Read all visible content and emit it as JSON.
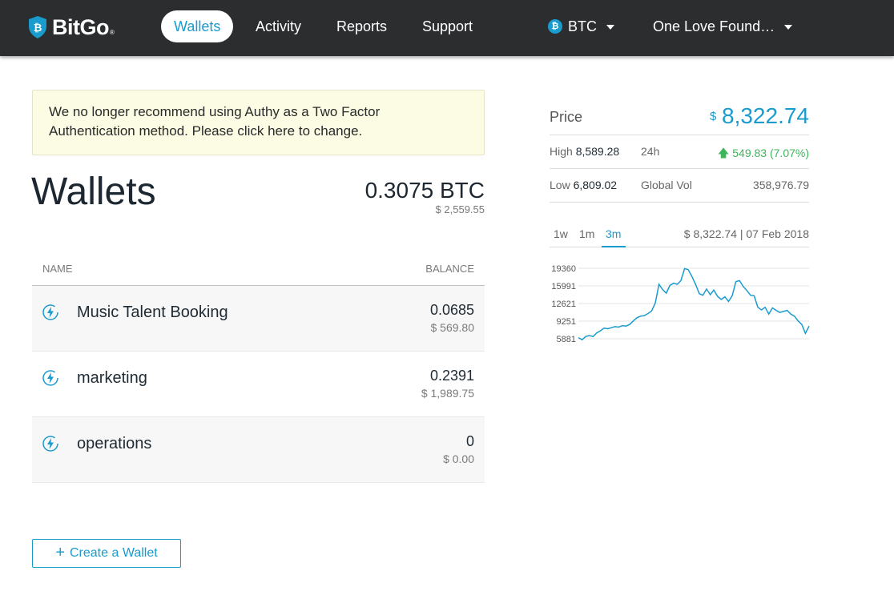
{
  "nav": {
    "logo_text": "BitGo",
    "logo_reg": "®",
    "items": [
      {
        "label": "Wallets",
        "active": true
      },
      {
        "label": "Activity",
        "active": false
      },
      {
        "label": "Reports",
        "active": false
      },
      {
        "label": "Support",
        "active": false
      }
    ],
    "coin": {
      "label": "BTC",
      "icon": "bitcoin-icon"
    },
    "enterprise": {
      "label": "One Love Found…"
    }
  },
  "alert": {
    "text": "We no longer recommend using Authy as a Two Factor Authentication method. Please click here to change."
  },
  "wallets": {
    "title": "Wallets",
    "total_btc": "0.3075 BTC",
    "total_usd": "$ 2,559.55",
    "columns": {
      "name": "NAME",
      "balance": "BALANCE"
    },
    "rows": [
      {
        "name": "Music Talent Booking",
        "balance": "0.0685",
        "usd": "$ 569.80",
        "icon": "lightning-icon"
      },
      {
        "name": "marketing",
        "balance": "0.2391",
        "usd": "$ 1,989.75",
        "icon": "lightning-icon"
      },
      {
        "name": "operations",
        "balance": "0",
        "usd": "$ 0.00",
        "icon": "lightning-icon"
      }
    ],
    "create_label": "Create a Wallet"
  },
  "price_panel": {
    "label": "Price",
    "currency_symbol": "$",
    "price": "8,322.74",
    "high_label": "High",
    "high_value": "8,589.28",
    "period_label": "24h",
    "change": "549.83 (7.07%)",
    "low_label": "Low",
    "low_value": "6,809.02",
    "vol_label": "Global Vol",
    "vol_value": "358,976.79",
    "ranges": [
      "1w",
      "1m",
      "3m"
    ],
    "active_range": "3m",
    "date_text": "$ 8,322.74 | 07 Feb 2018",
    "accent_color": "#1a9bce",
    "up_color": "#3db55a"
  },
  "chart_data": {
    "type": "line",
    "title": "",
    "xlabel": "",
    "ylabel": "",
    "yticks": [
      19360,
      15991,
      12621,
      9251,
      5881
    ],
    "ylim": [
      5881,
      19360
    ],
    "grid": true,
    "series": [
      {
        "values": [
          6100,
          5700,
          6300,
          6500,
          6300,
          7000,
          7400,
          7900,
          7800,
          8000,
          8200,
          8100,
          8400,
          8300,
          8600,
          9300,
          9900,
          10200,
          10300,
          10700,
          11200,
          12700,
          16300,
          15300,
          14600,
          16100,
          16500,
          16300,
          17000,
          19300,
          19100,
          17800,
          16300,
          14500,
          14200,
          15400,
          14300,
          15200,
          14000,
          13400,
          13900,
          13000,
          14100,
          16800,
          17000,
          15900,
          15100,
          14200,
          14100,
          11900,
          11400,
          11900,
          10600,
          11800,
          11300,
          10900,
          11100,
          11300,
          10600,
          10200,
          9300,
          8600,
          6900,
          8300
        ]
      }
    ]
  }
}
